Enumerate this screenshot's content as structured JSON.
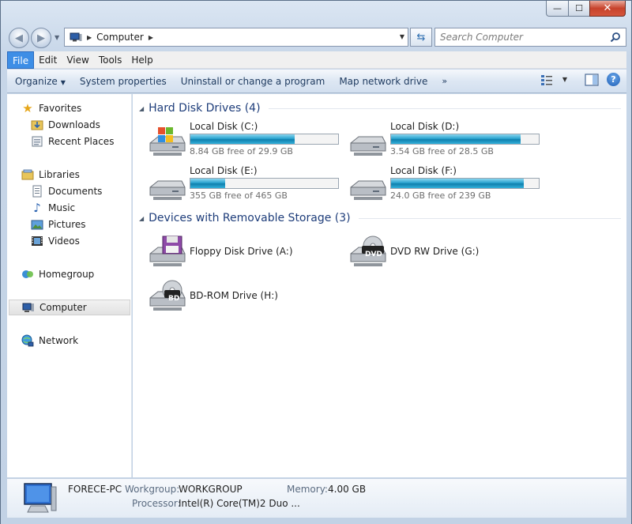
{
  "window": {
    "min_glyph": "—",
    "max_glyph": "☐",
    "close_glyph": "✕"
  },
  "address": {
    "crumb": "Computer",
    "search_placeholder": "Search Computer"
  },
  "menu": [
    "File",
    "Edit",
    "View",
    "Tools",
    "Help"
  ],
  "commands": {
    "organize": "Organize",
    "system_properties": "System properties",
    "uninstall": "Uninstall or change a program",
    "map_drive": "Map network drive",
    "more": "»"
  },
  "nav": {
    "favorites": "Favorites",
    "downloads": "Downloads",
    "recent": "Recent Places",
    "libraries": "Libraries",
    "documents": "Documents",
    "music": "Music",
    "pictures": "Pictures",
    "videos": "Videos",
    "homegroup": "Homegroup",
    "computer": "Computer",
    "network": "Network"
  },
  "groups": {
    "hdd": "Hard Disk Drives (4)",
    "removable": "Devices with Removable Storage (3)"
  },
  "drives": [
    {
      "name": "Local Disk (C:)",
      "free": "8.84 GB free of 29.9 GB",
      "used_fraction": 0.704
    },
    {
      "name": "Local Disk (D:)",
      "free": "3.54 GB free of 28.5 GB",
      "used_fraction": 0.876
    },
    {
      "name": "Local Disk (E:)",
      "free": "355 GB free of 465 GB",
      "used_fraction": 0.237
    },
    {
      "name": "Local Disk (F:)",
      "free": "24.0 GB free of 239 GB",
      "used_fraction": 0.9
    }
  ],
  "removable": [
    {
      "name": "Floppy Disk Drive (A:)"
    },
    {
      "name": "DVD RW Drive (G:)",
      "badge": "DVD"
    },
    {
      "name": "BD-ROM Drive (H:)",
      "badge": "BD"
    }
  ],
  "details": {
    "pc_name": "FORECE-PC",
    "workgroup_label": "Workgroup:",
    "workgroup": "WORKGROUP",
    "memory_label": "Memory:",
    "memory": "4.00 GB",
    "processor_label": "Processor:",
    "processor": "Intel(R) Core(TM)2 Duo ..."
  }
}
